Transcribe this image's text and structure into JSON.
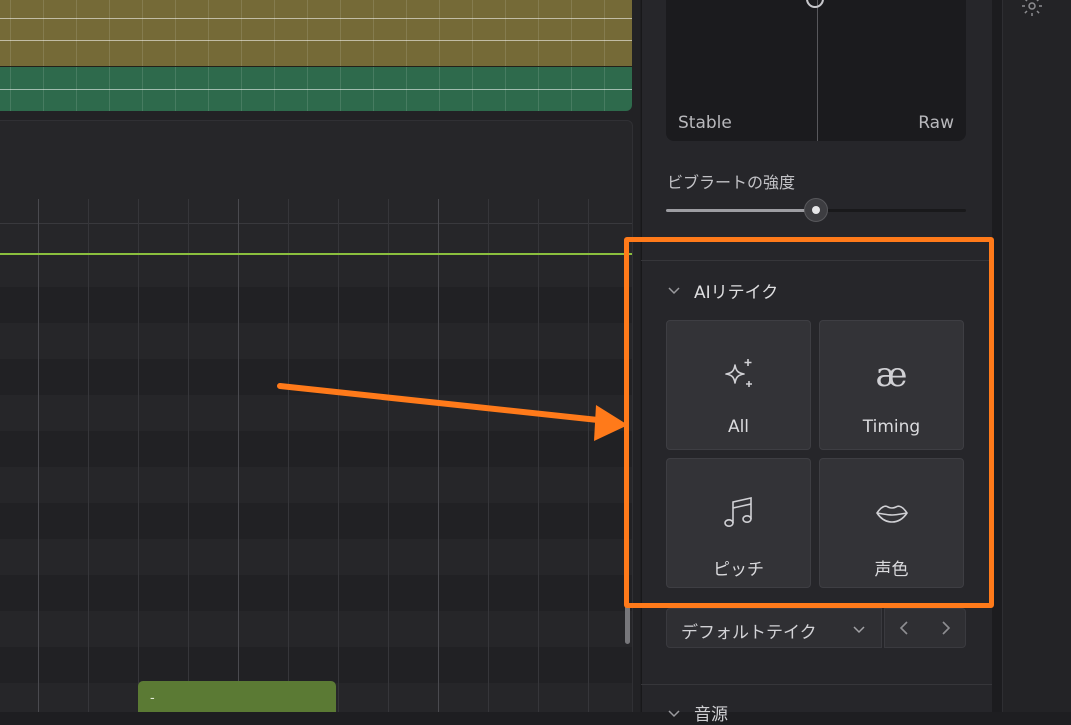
{
  "xy_pad": {
    "left_label": "Stable",
    "right_label": "Raw"
  },
  "vibrato": {
    "label": "ビブラートの強度",
    "value_percent": 50
  },
  "ai_retake": {
    "title": "AIリテイク",
    "buttons": [
      {
        "id": "all",
        "label": "All",
        "icon": "sparkles-icon"
      },
      {
        "id": "timing",
        "label": "Timing",
        "icon": "ae-ligature-icon",
        "glyph": "æ"
      },
      {
        "id": "pitch",
        "label": "ピッチ",
        "icon": "music-note-icon"
      },
      {
        "id": "voice",
        "label": "声色",
        "icon": "lips-icon"
      }
    ],
    "take_select": {
      "value": "デフォルトテイク"
    }
  },
  "next_section": {
    "title": "音源"
  },
  "piano_roll": {
    "note_label": "-"
  },
  "colors": {
    "highlight": "#ff7a1a",
    "track_yellow": "#756a37",
    "track_green": "#2e6a4c",
    "note_green": "#5b7a34",
    "pitch_line": "#8bbf3e"
  }
}
